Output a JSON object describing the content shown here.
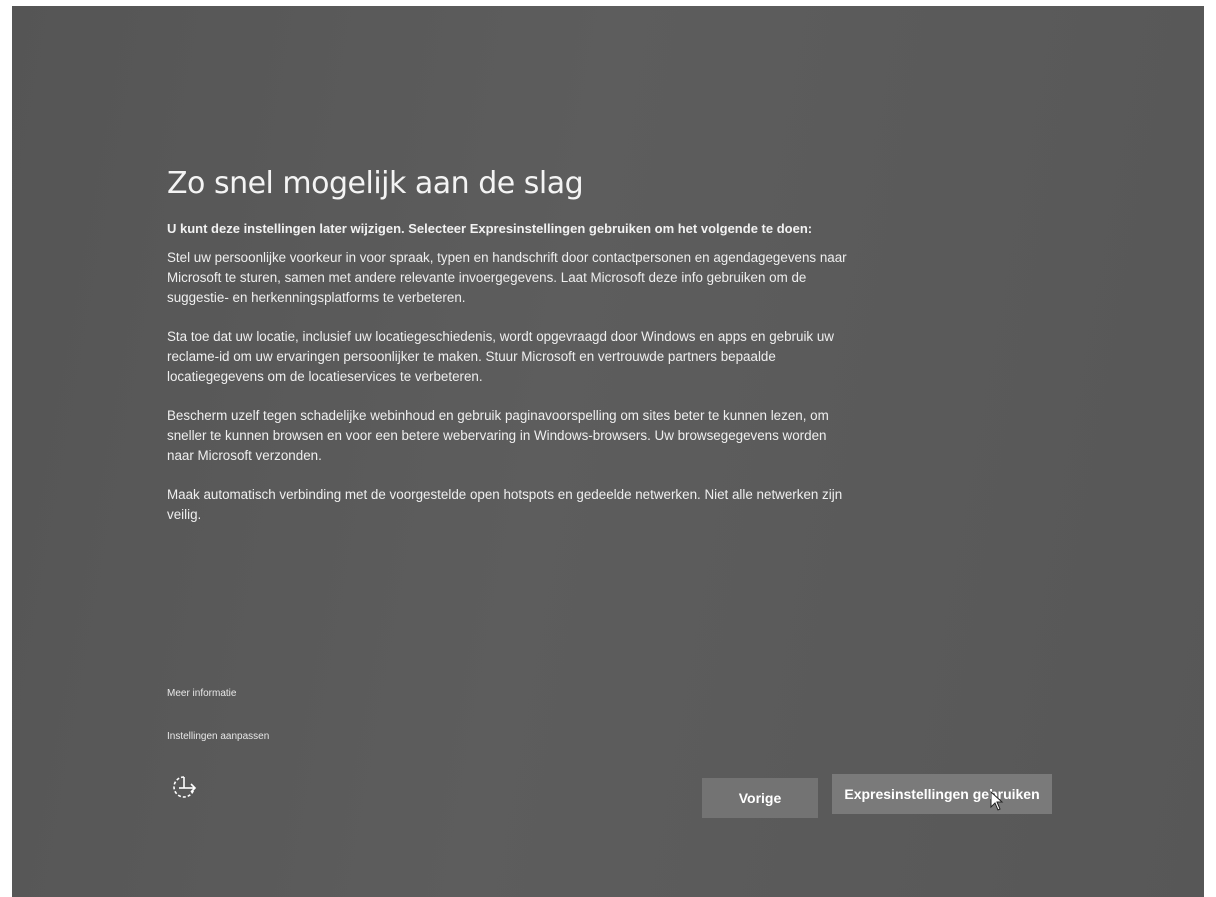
{
  "page": {
    "title": "Zo snel mogelijk aan de slag",
    "intro": "U kunt deze instellingen later wijzigen. Selecteer Expresinstellingen gebruiken om het volgende te doen:",
    "paragraphs": [
      "Stel uw persoonlijke voorkeur in voor spraak, typen en handschrift door contactpersonen en agendagegevens naar Microsoft te sturen, samen met andere relevante invoergegevens. Laat Microsoft deze info gebruiken om de suggestie- en herkenningsplatforms te verbeteren.",
      "Sta toe dat uw locatie, inclusief uw locatiegeschiedenis, wordt opgevraagd door Windows en apps en gebruik uw reclame-id om uw ervaringen persoonlijker te maken. Stuur Microsoft en vertrouwde partners bepaalde locatiegegevens om de locatieservices te verbeteren.",
      "Bescherm uzelf tegen schadelijke webinhoud en gebruik paginavoorspelling om sites beter te kunnen lezen, om sneller te kunnen browsen en voor een betere webervaring in Windows-browsers. Uw browsegegevens worden naar Microsoft verzonden.",
      "Maak automatisch verbinding met de voorgestelde open hotspots en gedeelde netwerken. Niet alle netwerken zijn veilig."
    ]
  },
  "links": {
    "more_info": "Meer informatie",
    "customize": "Instellingen aanpassen"
  },
  "buttons": {
    "back": "Vorige",
    "express": "Expresinstellingen gebruiken"
  },
  "icons": {
    "accessibility": "ease-of-access-icon",
    "cursor": "mouse-pointer-icon"
  },
  "colors": {
    "background": "#5a5a5a",
    "button": "#737373",
    "text": "#ffffff"
  }
}
